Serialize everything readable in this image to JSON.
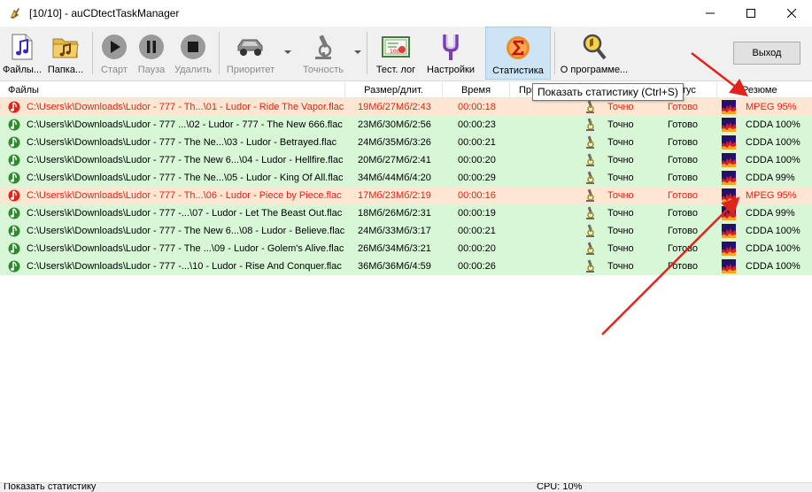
{
  "window": {
    "title": "[10/10] - auCDtectTaskManager"
  },
  "toolbar": {
    "files_label": "Файлы...",
    "folder_label": "Папка...",
    "start_label": "Старт",
    "pause_label": "Пауза",
    "delete_label": "Удалить",
    "priority_label": "Приоритет",
    "accuracy_label": "Точность",
    "testlog_label": "Тест. лог",
    "settings_label": "Настройки",
    "stats_label": "Статистика",
    "about_label": "О программе...",
    "exit_label": "Выход"
  },
  "tooltip": "Показать статистику (Ctrl+S)",
  "columns": {
    "files": "Файлы",
    "size": "Размер/длит.",
    "time": "Время",
    "priority": "При",
    "accuracy": "",
    "status": "атус",
    "resume": "Резюме"
  },
  "rows": [
    {
      "path": "C:\\Users\\k\\Downloads\\Ludor - 777 - Th...\\01 - Ludor - Ride The Vapor.flac",
      "size": "19Мб/27Мб/2:43",
      "time": "00:00:18",
      "accuracy": "Точно",
      "status": "Готово",
      "resume": "MPEG 95%",
      "state": "warn"
    },
    {
      "path": "C:\\Users\\k\\Downloads\\Ludor - 777 ...\\02 - Ludor - 777 - The New 666.flac",
      "size": "23Мб/30Мб/2:56",
      "time": "00:00:23",
      "accuracy": "Точно",
      "status": "Готово",
      "resume": "CDDA 100%",
      "state": "ok"
    },
    {
      "path": "C:\\Users\\k\\Downloads\\Ludor - 777 - The Ne...\\03 - Ludor - Betrayed.flac",
      "size": "24Мб/35Мб/3:26",
      "time": "00:00:21",
      "accuracy": "Точно",
      "status": "Готово",
      "resume": "CDDA 100%",
      "state": "ok"
    },
    {
      "path": "C:\\Users\\k\\Downloads\\Ludor - 777 - The New 6...\\04 - Ludor - Hellfire.flac",
      "size": "20Мб/27Мб/2:41",
      "time": "00:00:20",
      "accuracy": "Точно",
      "status": "Готово",
      "resume": "CDDA 100%",
      "state": "ok"
    },
    {
      "path": "C:\\Users\\k\\Downloads\\Ludor - 777 - The Ne...\\05 - Ludor - King Of All.flac",
      "size": "34Мб/44Мб/4:20",
      "time": "00:00:29",
      "accuracy": "Точно",
      "status": "Готово",
      "resume": "CDDA 99%",
      "state": "ok"
    },
    {
      "path": "C:\\Users\\k\\Downloads\\Ludor - 777 - Th...\\06 - Ludor - Piece by Piece.flac",
      "size": "17Мб/23Мб/2:19",
      "time": "00:00:16",
      "accuracy": "Точно",
      "status": "Готово",
      "resume": "MPEG 95%",
      "state": "warn"
    },
    {
      "path": "C:\\Users\\k\\Downloads\\Ludor - 777 -...\\07 - Ludor - Let The Beast Out.flac",
      "size": "18Мб/26Мб/2:31",
      "time": "00:00:19",
      "accuracy": "Точно",
      "status": "Готово",
      "resume": "CDDA 99%",
      "state": "ok"
    },
    {
      "path": "C:\\Users\\k\\Downloads\\Ludor - 777 - The New 6...\\08 - Ludor - Believe.flac",
      "size": "24Мб/33Мб/3:17",
      "time": "00:00:21",
      "accuracy": "Точно",
      "status": "Готово",
      "resume": "CDDA 100%",
      "state": "ok"
    },
    {
      "path": "C:\\Users\\k\\Downloads\\Ludor - 777 - The ...\\09 - Ludor - Golem's Alive.flac",
      "size": "26Мб/34Мб/3:21",
      "time": "00:00:20",
      "accuracy": "Точно",
      "status": "Готово",
      "resume": "CDDA 100%",
      "state": "ok"
    },
    {
      "path": "C:\\Users\\k\\Downloads\\Ludor - 777 -...\\10 - Ludor - Rise And Conquer.flac",
      "size": "36Мб/36Мб/4:59",
      "time": "00:00:26",
      "accuracy": "Точно",
      "status": "Готово",
      "resume": "CDDA 100%",
      "state": "ok"
    }
  ],
  "statusbar": {
    "left": "Показать статистику",
    "right": "CPU: 10%"
  },
  "colors": {
    "warn_bg": "#fde7d2",
    "warn_text": "#e3231a",
    "ok_bg": "#d7f7d7",
    "arrow": "#e0241b",
    "active_tool_bg": "#cde4f5"
  }
}
